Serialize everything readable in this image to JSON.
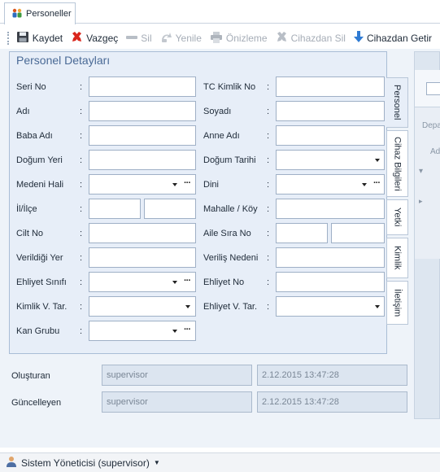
{
  "tab": {
    "label": "Personeller"
  },
  "toolbar": {
    "save": "Kaydet",
    "cancel": "Vazgeç",
    "delete": "Sil",
    "refresh": "Yenile",
    "preview": "Önizleme",
    "device_delete": "Cihazdan Sil",
    "device_get": "Cihazdan Getir"
  },
  "details": {
    "title": "Personel Detayları",
    "colon": ":",
    "fields": {
      "seri_no": "Seri No",
      "adi": "Adı",
      "baba_adi": "Baba Adı",
      "dogum_yeri": "Doğum Yeri",
      "medeni_hali": "Medeni Hali",
      "il_ilce": "İl/İlçe",
      "cilt_no": "Cilt No",
      "verildigi_yer": "Verildiği Yer",
      "ehliyet_sinifi": "Ehliyet Sınıfı",
      "kimlik_v_tar": "Kimlik V. Tar.",
      "kan_grubu": "Kan Grubu",
      "tc_kimlik_no": "TC Kimlik No",
      "soyadi": "Soyadı",
      "anne_adi": "Anne Adı",
      "dogum_tarihi": "Doğum Tarihi",
      "dini": "Dini",
      "mahalle_koy": "Mahalle / Köy",
      "aile_sira_no": "Aile Sıra No",
      "verilis_nedeni": "Veriliş Nedeni",
      "ehliyet_no": "Ehliyet No",
      "ehliyet_v_tar": "Ehliyet V. Tar."
    }
  },
  "side_tabs": [
    "Personel",
    "Cihaz Bilgileri",
    "Yetki",
    "Kimlik",
    "İletişim"
  ],
  "audit": {
    "created_label": "Oluşturan",
    "created_by": "supervisor",
    "created_at": "2.12.2015 13:47:28",
    "updated_label": "Güncelleyen",
    "updated_by": "supervisor",
    "updated_at": "2.12.2015 13:47:28"
  },
  "right_panel": {
    "dep_text": "Depa",
    "ad_text": "Ad"
  },
  "status": {
    "user": "Sistem Yöneticisi (supervisor)"
  },
  "icons": {
    "tab": "people-icon",
    "save": "floppy-icon",
    "cancel": "red-x-icon",
    "delete": "minus-icon",
    "refresh": "refresh-icon",
    "preview": "printer-icon",
    "device_delete": "gray-x-icon",
    "device_get": "download-arrow-icon",
    "status": "user-icon"
  },
  "colors": {
    "accent": "#4a6a96",
    "cancel_red": "#d9261c",
    "download_blue": "#2f7bd3"
  }
}
